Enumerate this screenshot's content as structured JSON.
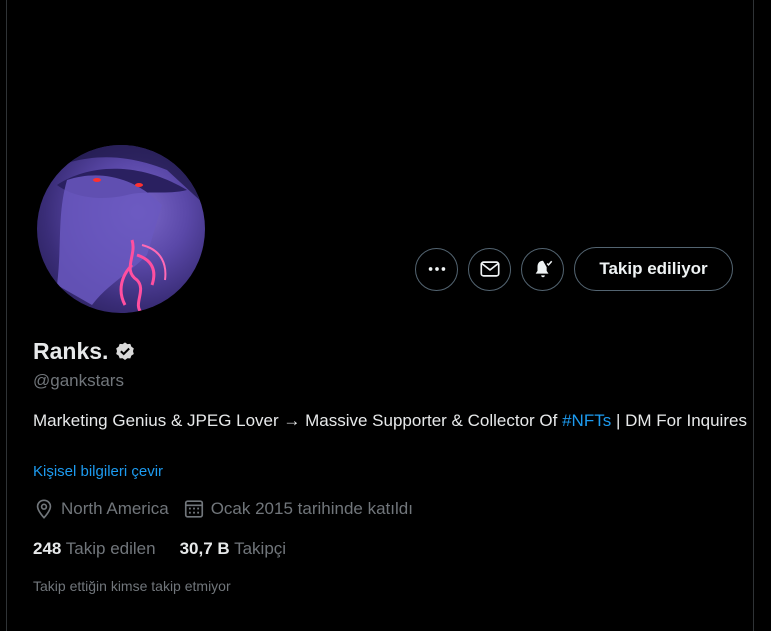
{
  "profile": {
    "display_name": "Ranks.",
    "handle": "@gankstars",
    "bio_parts": {
      "before": "Marketing Genius & JPEG Lover → Massive Supporter & Collector Of ",
      "hashtag": "#NFTs",
      "after": " | DM For Inquires"
    },
    "translate_link": "Kişisel bilgileri çevir",
    "location": "North America",
    "joined": "Ocak 2015 tarihinde katıldı"
  },
  "stats": {
    "following_count": "248",
    "following_label": "Takip edilen",
    "followers_count": "30,7 B",
    "followers_label": "Takipçi"
  },
  "follow_button_label": "Takip ediliyor",
  "note": "Takip ettiğin kimse takip etmiyor",
  "colors": {
    "background": "#000000",
    "accent": "#1d9bf0",
    "secondary_text": "#71767b",
    "primary_text": "#e7e9ea"
  },
  "icons": [
    "more-icon",
    "mail-icon",
    "bell-icon",
    "verified-icon",
    "location-icon",
    "calendar-icon"
  ]
}
